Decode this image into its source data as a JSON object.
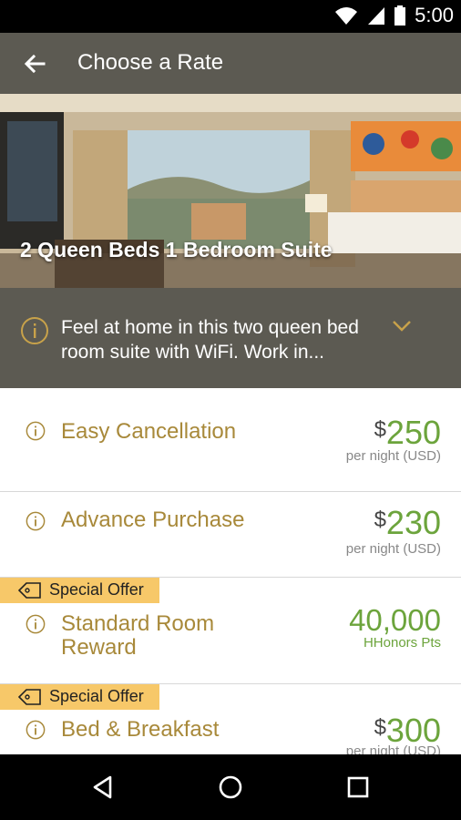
{
  "status_bar": {
    "time": "5:00",
    "icons": [
      "wifi-icon",
      "signal-icon",
      "battery-icon"
    ]
  },
  "app_bar": {
    "title": "Choose a Rate",
    "back_icon": "arrow-back-icon"
  },
  "room": {
    "name": "2 Queen Beds 1 Bedroom Suite"
  },
  "description": {
    "text": "Feel at home in this two queen bed room suite with WiFi. Work in...",
    "expand_icon": "chevron-down-icon"
  },
  "rates": [
    {
      "name": "Easy Cancellation",
      "currency": "$",
      "amount": "250",
      "unit": "per night (USD)",
      "special": null
    },
    {
      "name": "Advance Purchase",
      "currency": "$",
      "amount": "230",
      "unit": "per night (USD)",
      "special": null
    },
    {
      "name": "Standard Room Reward",
      "currency": "",
      "amount": "40,000",
      "unit": "HHonors Pts",
      "special": "Special Offer"
    },
    {
      "name": "Bed & Breakfast",
      "currency": "$",
      "amount": "300",
      "unit": "per night (USD)",
      "special": "Special Offer"
    }
  ],
  "colors": {
    "header": "#5c5a52",
    "gold": "#a8893a",
    "green": "#6ca43c",
    "badge": "#f7c869"
  },
  "nav_bar": {
    "icons": [
      "back-triangle-icon",
      "home-circle-icon",
      "recents-square-icon"
    ]
  }
}
